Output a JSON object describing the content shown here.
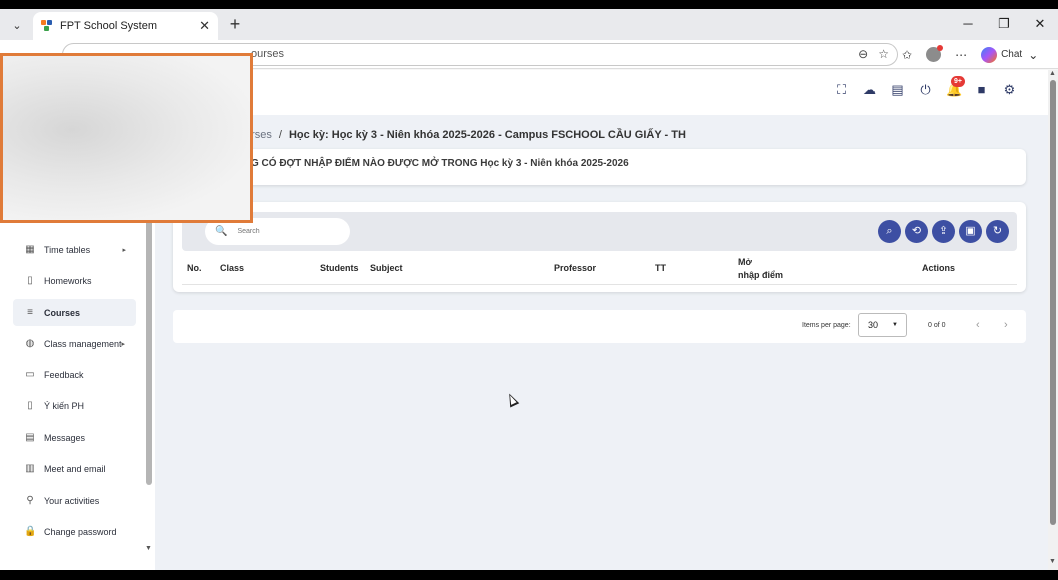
{
  "browser": {
    "tab_title": "FPT School System",
    "url_text": "ourses",
    "chat_label": "Chat"
  },
  "topbar": {
    "notification_badge": "9+"
  },
  "sidebar": {
    "items": [
      {
        "label": "Time tables",
        "icon": "table-icon",
        "arrow": "▸"
      },
      {
        "label": "Homeworks",
        "icon": "document-icon"
      },
      {
        "label": "Courses",
        "icon": "list-icon",
        "active": true
      },
      {
        "label": "Class management",
        "icon": "globe-icon",
        "arrow": "▸"
      },
      {
        "label": "Feedback",
        "icon": "feedback-icon"
      },
      {
        "label": "Ý kiến PH",
        "icon": "bookmark-icon"
      },
      {
        "label": "Messages",
        "icon": "message-icon"
      },
      {
        "label": "Meet and email",
        "icon": "meet-icon"
      },
      {
        "label": "Your activities",
        "icon": "activity-icon"
      },
      {
        "label": "Change password",
        "icon": "lock-icon"
      }
    ]
  },
  "breadcrumb": {
    "link": "urses",
    "separator": "/",
    "current": "Học kỳ: Học kỳ 3 - Niên khóa 2025-2026 - Campus FSCHOOL CẦU GIẤY - TH"
  },
  "notice": {
    "text": "G CÓ ĐỢT NHẬP ĐIỂM NÀO ĐƯỢC MỞ TRONG Học kỳ 3 - Niên khóa 2025-2026"
  },
  "search": {
    "placeholder": "Search"
  },
  "table": {
    "columns": {
      "no": "No.",
      "class": "Class",
      "students": "Students",
      "subject": "Subject",
      "professor": "Professor",
      "tt": "TT",
      "mo_line1": "Mở",
      "mo_line2": "nhập điểm",
      "actions": "Actions"
    },
    "rows": []
  },
  "pagination": {
    "items_per_page_label": "Items per page:",
    "items_per_page_value": "30",
    "range": "0 of 0"
  },
  "colors": {
    "accent": "#3d4fa3",
    "background": "#eef1f6",
    "redaction_border": "#e07b39"
  }
}
